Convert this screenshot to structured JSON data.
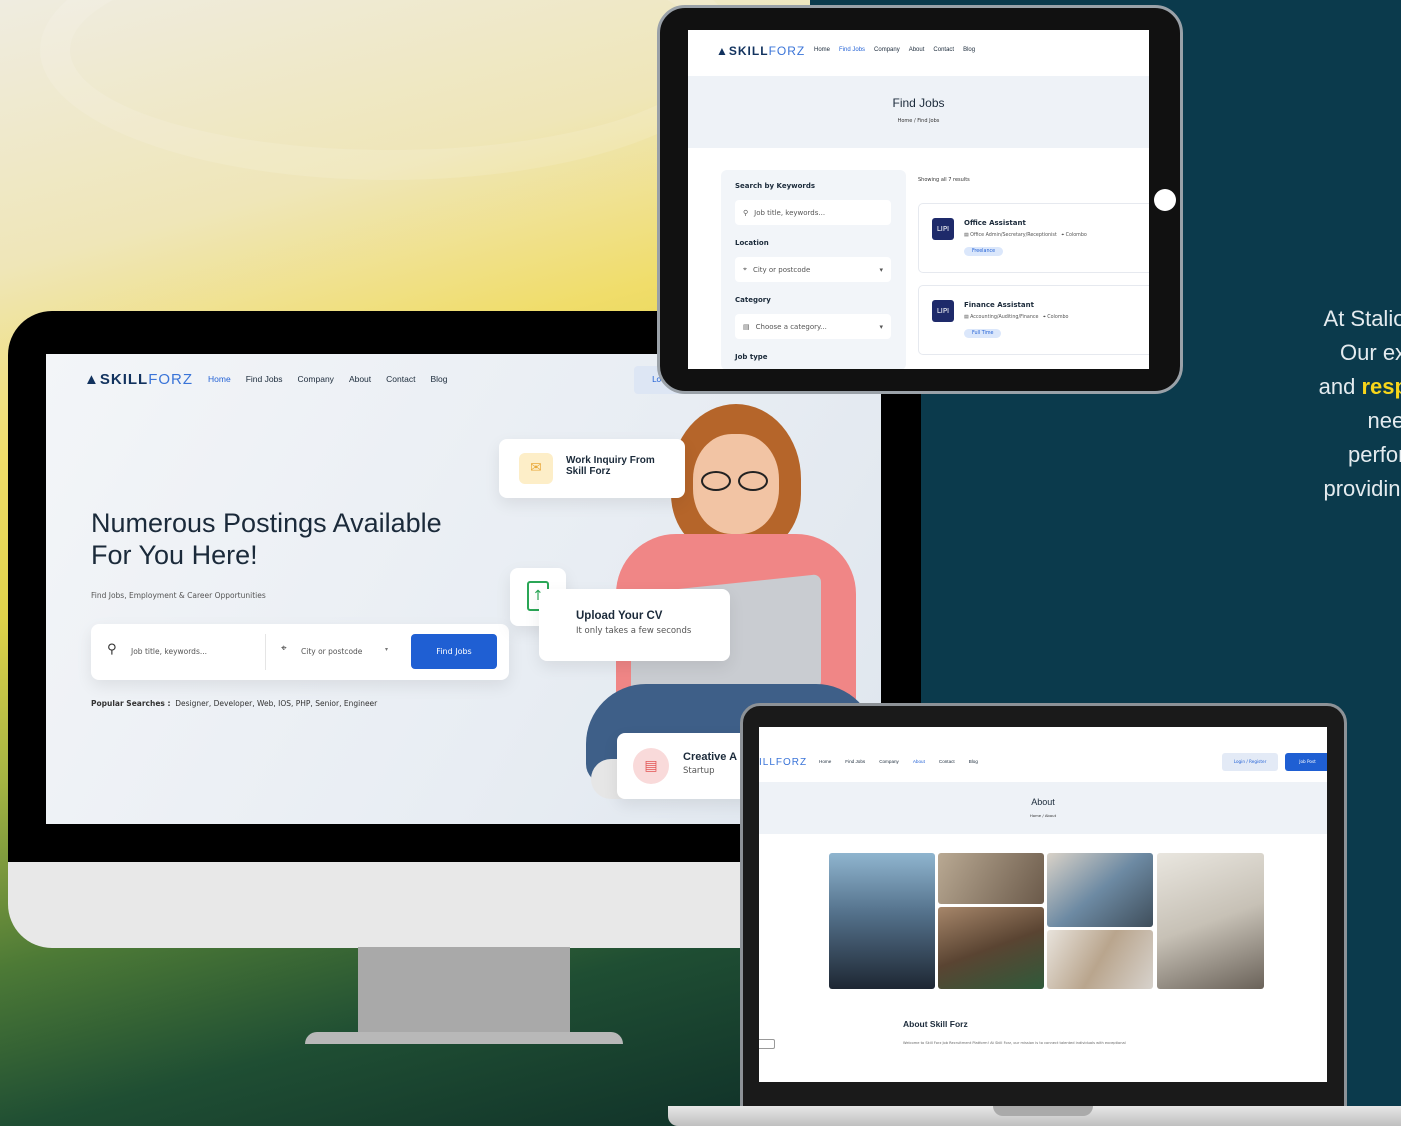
{
  "marketing": {
    "line1": "At Stalione Gr",
    "line2": "Our expert",
    "line3_pre": "and ",
    "line3_bold": "responsiv",
    "line4": "need",
    "line5": "performa",
    "line6": "providing a se"
  },
  "monitor": {
    "logo_skill": "SKILL",
    "logo_forz": "FORZ",
    "nav": [
      "Home",
      "Find Jobs",
      "Company",
      "About",
      "Contact",
      "Blog"
    ],
    "login_label": "Lo",
    "hero_title_1": "Numerous Postings Available",
    "hero_title_2": "For You Here!",
    "hero_sub": "Find Jobs, Employment & Career Opportunities",
    "search_placeholder": "Job title, keywords...",
    "location_placeholder": "City or postcode",
    "find_button": "Find Jobs",
    "popular_label": "Popular Searches :",
    "popular_items": "Designer, Developer, Web, IOS, PHP, Senior, Engineer",
    "card1_title": "Work Inquiry From",
    "card1_sub": "Skill Forz",
    "card2_title": "Upload Your CV",
    "card2_sub": "It only takes a few seconds",
    "card3_title": "Creative A",
    "card3_sub": "Startup"
  },
  "tablet": {
    "logo_skill": "SKILL",
    "logo_forz": "FORZ",
    "nav": [
      "Home",
      "Find Jobs",
      "Company",
      "About",
      "Contact",
      "Blog"
    ],
    "page_title": "Find Jobs",
    "breadcrumb_home": "Home",
    "breadcrumb_current": "/ Find Jobs",
    "filter_keywords_label": "Search by Keywords",
    "filter_keywords_placeholder": "Job title, keywords...",
    "filter_location_label": "Location",
    "filter_location_placeholder": "City or postcode",
    "filter_category_label": "Category",
    "filter_category_placeholder": "Choose a category...",
    "filter_jobtype_label": "Job type",
    "results_count": "Showing all 7 results",
    "jobs": [
      {
        "logo": "LIPI",
        "title": "Office Assistant",
        "category": "Office Admin/Secretary/Receptionist",
        "location": "Colombo",
        "type": "Freelance"
      },
      {
        "logo": "LIPI",
        "title": "Finance Assistant",
        "category": "Accounting/Auditing/Finance",
        "location": "Colombo",
        "type": "Full Time"
      }
    ]
  },
  "laptop": {
    "logo_partial": "ILLFORZ",
    "nav": [
      "Home",
      "Find Jobs",
      "Company",
      "About",
      "Contact",
      "Blog"
    ],
    "login_button": "Login / Register",
    "jobpost_button": "Job Post",
    "page_title": "About",
    "breadcrumb": "Home / About",
    "section_title": "About Skill Forz",
    "section_text": "Welcome to Skill Forz Job Recruitment Platform! At Skill Forz, our mission is to connect talented individuals with exceptional"
  },
  "colors": {
    "accent": "#2563d6",
    "dark_bg": "#0b3a4c",
    "highlight": "#f7d51a"
  }
}
